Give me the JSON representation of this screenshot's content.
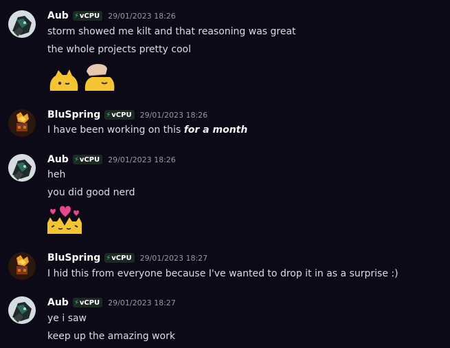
{
  "colors": {
    "background": "#0b0a16",
    "username": "#ffffff",
    "timestamp": "#949ba4",
    "bot_badge_bolt": "#3ec77b"
  },
  "messages": [
    {
      "author": "Aub",
      "badge": "vCPU",
      "timestamp": "29/01/2023 18:26",
      "avatar_icon": "aub-avatar-icon",
      "lines": [
        "storm showed me kilt and that reasoning was great",
        "the whole projects pretty cool"
      ],
      "emojis": [
        "yellow-blob-cat-emoji",
        "hand-petting-blob-emoji"
      ]
    },
    {
      "author": "BluSpring",
      "badge": "vCPU",
      "timestamp": "29/01/2023 18:26",
      "avatar_icon": "bluspring-avatar-icon",
      "line_prefix": "I have been working on this ",
      "line_emphasis": "for a month"
    },
    {
      "author": "Aub",
      "badge": "vCPU",
      "timestamp": "29/01/2023 18:26",
      "avatar_icon": "aub-avatar-icon",
      "lines": [
        "heh",
        "you did good nerd"
      ],
      "emojis": [
        "kissing-cats-hearts-emoji"
      ]
    },
    {
      "author": "BluSpring",
      "badge": "vCPU",
      "timestamp": "29/01/2023 18:27",
      "avatar_icon": "bluspring-avatar-icon",
      "lines": [
        "I hid this from everyone because I've wanted to drop it in as a surprise :)"
      ]
    },
    {
      "author": "Aub",
      "badge": "vCPU",
      "timestamp": "29/01/2023 18:27",
      "avatar_icon": "aub-avatar-icon",
      "lines": [
        "ye i saw",
        "keep up the amazing work"
      ]
    }
  ]
}
